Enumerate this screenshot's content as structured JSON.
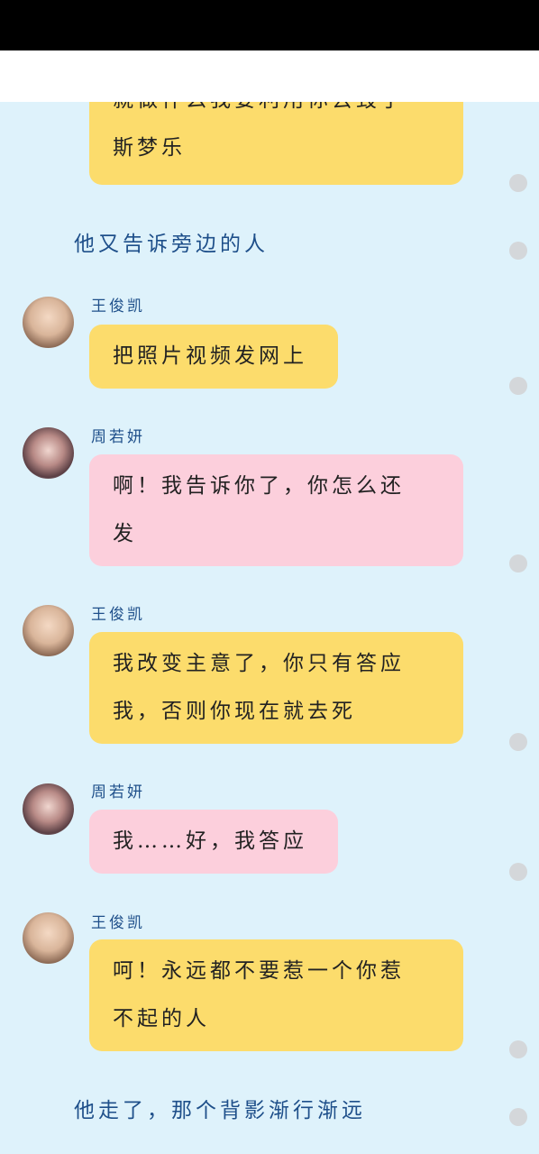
{
  "messages": {
    "top_bubble": {
      "lines": [
        "就做什么我要利用你去毁了",
        "斯梦乐"
      ]
    },
    "narration_1": "他又告诉旁边的人",
    "msg_1": {
      "sender": "王俊凯",
      "lines": [
        "把照片视频发网上"
      ]
    },
    "msg_2": {
      "sender": "周若妍",
      "lines": [
        "啊！我告诉你了，你怎么还",
        "发"
      ]
    },
    "msg_3": {
      "sender": "王俊凯",
      "lines": [
        "我改变主意了，你只有答应",
        "我，否则你现在就去死"
      ]
    },
    "msg_4": {
      "sender": "周若妍",
      "lines": [
        "我……好，我答应"
      ]
    },
    "msg_5": {
      "sender": "王俊凯",
      "lines": [
        "呵！永远都不要惹一个你惹",
        "不起的人"
      ]
    },
    "narration_2": "他走了，那个背影渐行渐远"
  },
  "colors": {
    "background": "#def2fb",
    "male_bubble": "#fcdc6c",
    "female_bubble": "#fccfdc",
    "narration_text": "#1e4f8a"
  }
}
